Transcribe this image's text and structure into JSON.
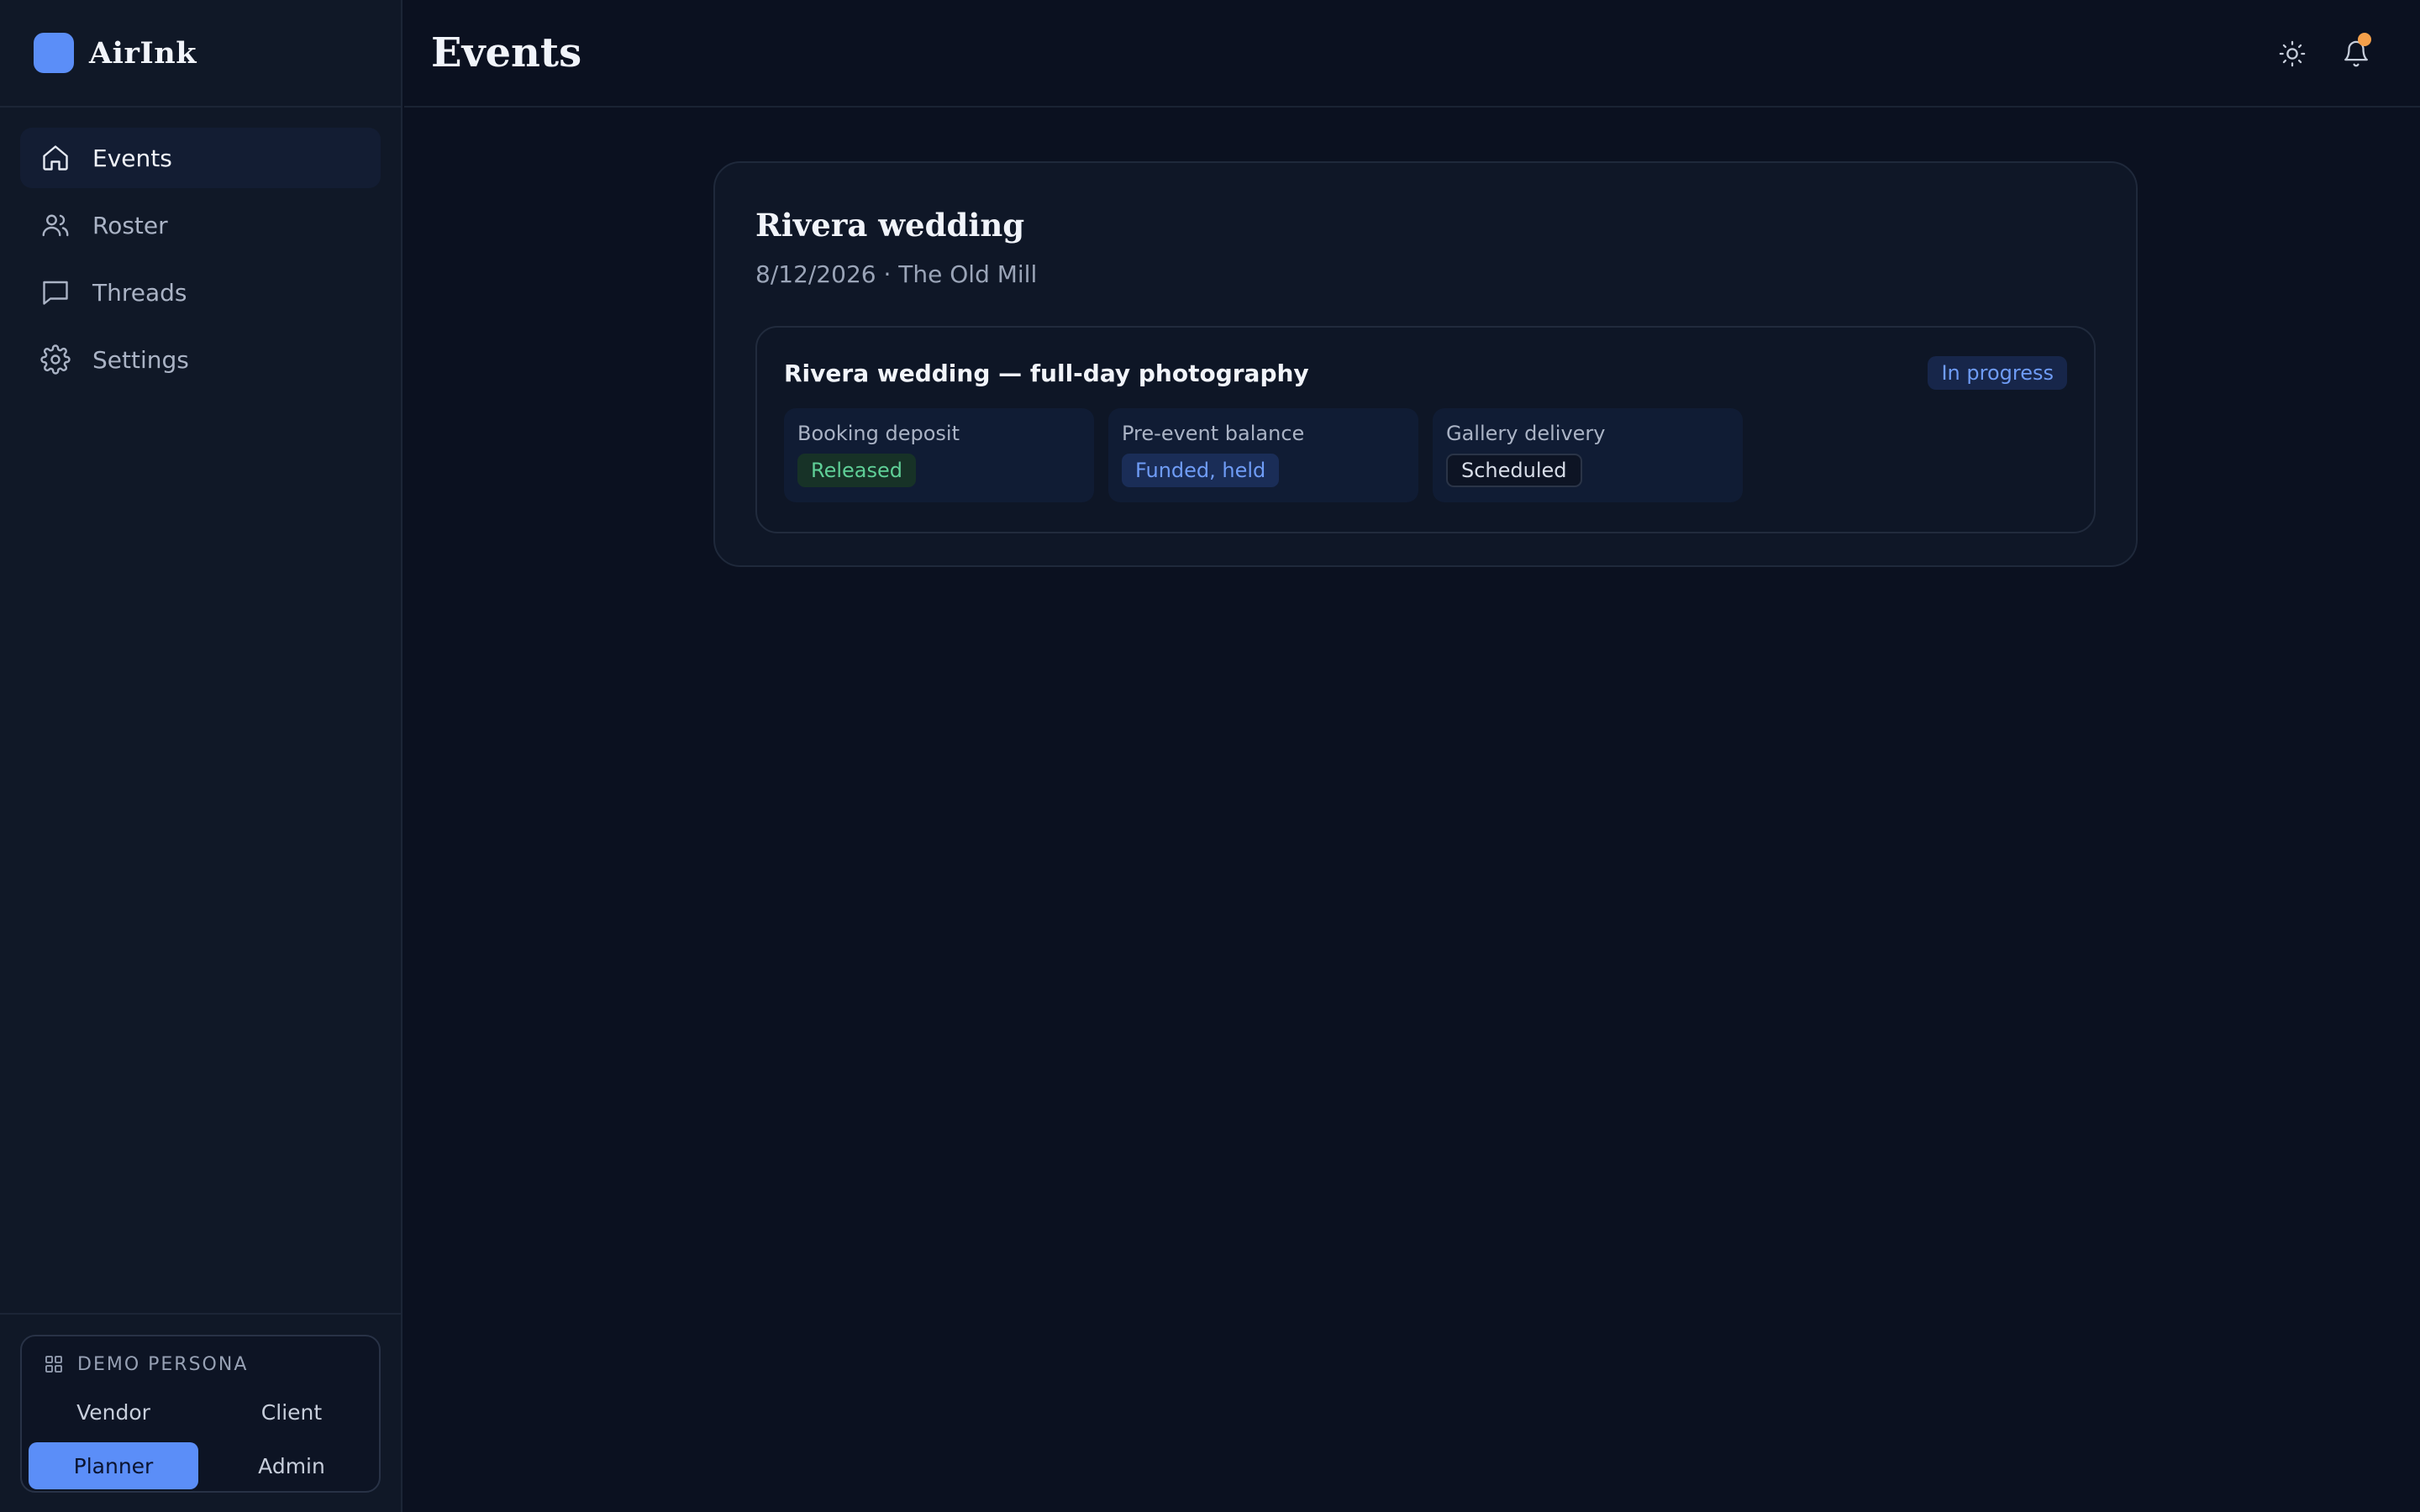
{
  "app": {
    "name": "AirInk",
    "colors": {
      "accent": "#5b8ef8",
      "background": "#0b1120",
      "notification": "#f5a04a"
    }
  },
  "sidebar": {
    "items": [
      {
        "label": "Events",
        "icon": "home-icon",
        "active": true
      },
      {
        "label": "Roster",
        "icon": "users-icon",
        "active": false
      },
      {
        "label": "Threads",
        "icon": "message-icon",
        "active": false
      },
      {
        "label": "Settings",
        "icon": "gear-icon",
        "active": false
      }
    ],
    "persona": {
      "title": "DEMO PERSONA",
      "options": [
        "Vendor",
        "Client",
        "Planner",
        "Admin"
      ],
      "selected": "Planner"
    }
  },
  "header": {
    "title": "Events",
    "actions": [
      "theme-toggle-icon",
      "bell-icon"
    ]
  },
  "event": {
    "title": "Rivera wedding",
    "meta": "8/12/2026 · The Old Mill",
    "contract": {
      "title": "Rivera wedding — full-day photography",
      "status": "In progress",
      "milestones": [
        {
          "label": "Booking deposit",
          "status": "Released"
        },
        {
          "label": "Pre-event balance",
          "status": "Funded, held"
        },
        {
          "label": "Gallery delivery",
          "status": "Scheduled"
        }
      ]
    }
  }
}
